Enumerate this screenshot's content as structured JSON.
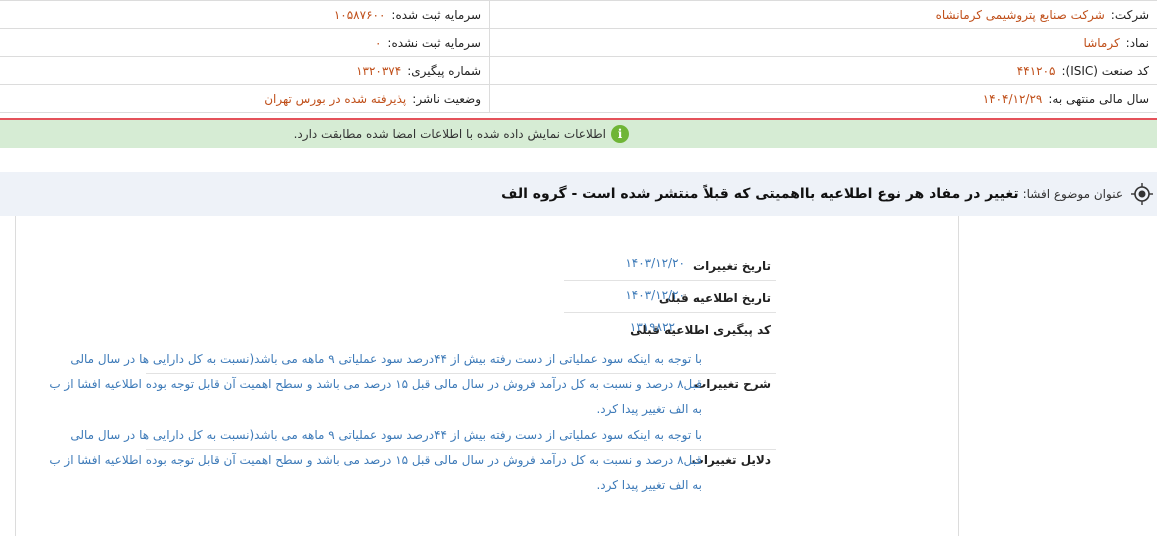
{
  "company_info": {
    "company_label": "شرکت:",
    "company_value": "شرکت صنایع پتروشیمی کرمانشاه",
    "registered_capital_label": "سرمایه ثبت شده:",
    "registered_capital_value": "۱۰۵۸۷۶۰۰",
    "symbol_label": "نماد:",
    "symbol_value": "کرماشا",
    "unregistered_capital_label": "سرمایه ثبت نشده:",
    "unregistered_capital_value": "۰",
    "isic_label": "کد صنعت (ISIC):",
    "isic_value": "۴۴۱۲۰۵",
    "tracking_label": "شماره پیگیری:",
    "tracking_value": "۱۳۲۰۳۷۴",
    "fiscal_year_label": "سال مالی منتهی به:",
    "fiscal_year_value": "۱۴۰۴/۱۲/۲۹",
    "publisher_status_label": "وضعیت ناشر:",
    "publisher_status_value": "پذیرفته شده در بورس تهران"
  },
  "notice": {
    "icon": "info-icon",
    "text": "اطلاعات نمایش داده شده با اطلاعات امضا شده مطابقت دارد."
  },
  "subject": {
    "label": "عنوان موضوع افشا:",
    "title": "تغییر در مفاد هر نوع اطلاعیه بااهمیتی که قبلاً منتشر شده است - گروه الف"
  },
  "details": {
    "change_date_label": "تاریخ تغییرات",
    "change_date_value": "۱۴۰۳/۱۲/۲۰",
    "prev_notice_date_label": "تاریخ اطلاعیه قبلی",
    "prev_notice_date_value": "۱۴۰۳/۱۲/۲۰",
    "prev_tracking_label": "کد پیگیری اطلاعیه قبلی",
    "prev_tracking_value": "۱۳۱۹۸۲۲",
    "change_desc_label": "شرح تغییرات",
    "change_desc_lines": [
      "با توجه به اینکه سود عملیاتی از دست رفته بیش از ۴۴درصد سود عملیاتی ۹ ماهه می باشد(نسبت به کل دارایی ها در سال مالی",
      "قبل۸ درصد و نسبت به کل درآمد فروش در سال مالی قبل ۱۵ درصد می باشد و سطح اهمیت آن قابل توجه بوده اطلاعیه افشا از ب",
      "به الف تغییر پیدا کرد."
    ],
    "change_reason_label": "دلایل تغییرات",
    "change_reason_lines": [
      "با توجه به اینکه سود عملیاتی از دست رفته بیش از ۴۴درصد سود عملیاتی ۹ ماهه می باشد(نسبت به کل دارایی ها در سال مالی",
      "قبل۸ درصد و نسبت به کل درآمد فروش در سال مالی قبل ۱۵ درصد می باشد و سطح اهمیت آن قابل توجه بوده اطلاعیه افشا از ب",
      "به الف تغییر پیدا کرد."
    ]
  }
}
